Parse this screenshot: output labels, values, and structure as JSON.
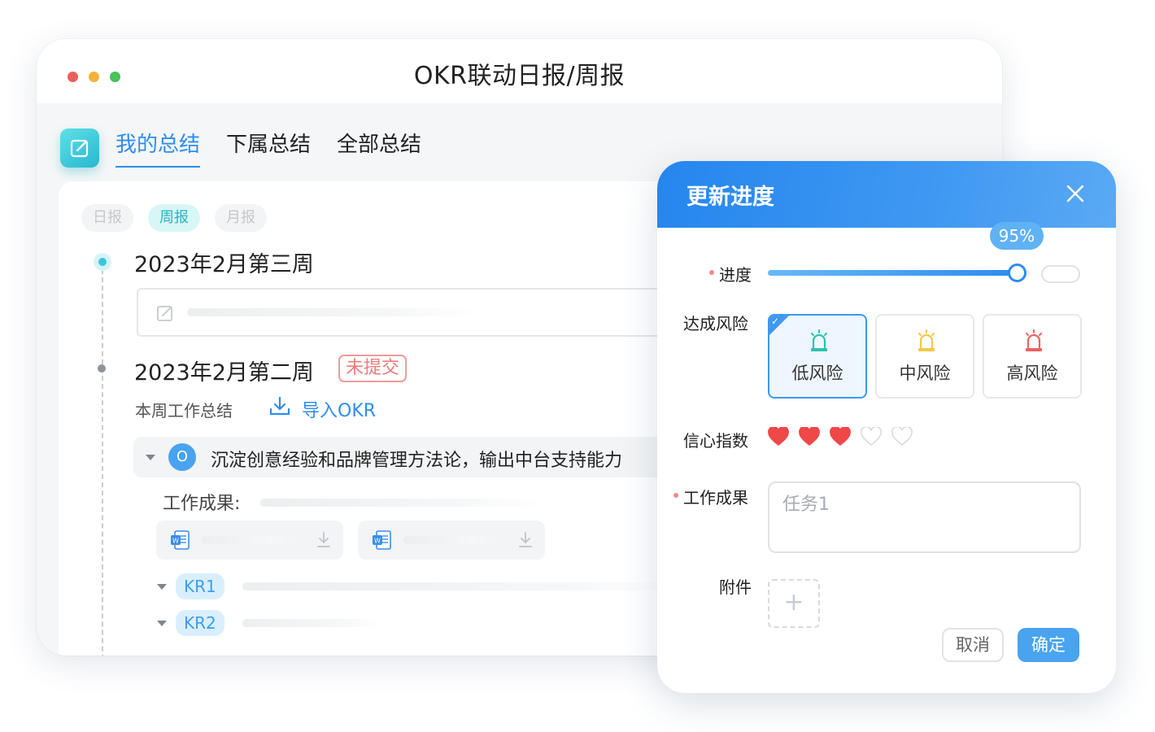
{
  "window": {
    "title": "OKR联动日报/周报"
  },
  "tabs": [
    {
      "label": "我的总结",
      "active": true
    },
    {
      "label": "下属总结",
      "active": false
    },
    {
      "label": "全部总结",
      "active": false
    }
  ],
  "period_chips": [
    {
      "label": "日报",
      "active": false
    },
    {
      "label": "周报",
      "active": true
    },
    {
      "label": "月报",
      "active": false
    }
  ],
  "timeline": {
    "week1": {
      "title": "2023年2月第三周"
    },
    "week2": {
      "title": "2023年2月第二周",
      "status_badge": "未提交",
      "summary_label": "本周工作总结",
      "import_label": "导入OKR",
      "objective": {
        "badge": "O",
        "text": "沉淀创意经验和品牌管理方法论，输出中台支持能力"
      },
      "result_label": "工作成果:",
      "key_results": [
        {
          "label": "KR1"
        },
        {
          "label": "KR2"
        }
      ]
    }
  },
  "dialog": {
    "title": "更新进度",
    "progress": {
      "label": "进度",
      "value": 95,
      "value_text": "95%"
    },
    "risk": {
      "label": "达成风险",
      "options": [
        {
          "label": "低风险",
          "color": "#2cc2b0",
          "selected": true
        },
        {
          "label": "中风险",
          "color": "#f2c84b",
          "selected": false
        },
        {
          "label": "高风险",
          "color": "#f06060",
          "selected": false
        }
      ]
    },
    "confidence": {
      "label": "信心指数",
      "value": 3,
      "max": 5
    },
    "work_result": {
      "label": "工作成果",
      "value": "任务1"
    },
    "attachment": {
      "label": "附件"
    },
    "buttons": {
      "cancel": "取消",
      "ok": "确定"
    }
  },
  "colors": {
    "accent": "#2f8df0",
    "brand_cyan": "#24b5c4",
    "warning_badge": "#ef7b7b",
    "heart_filled": "#f04848"
  }
}
